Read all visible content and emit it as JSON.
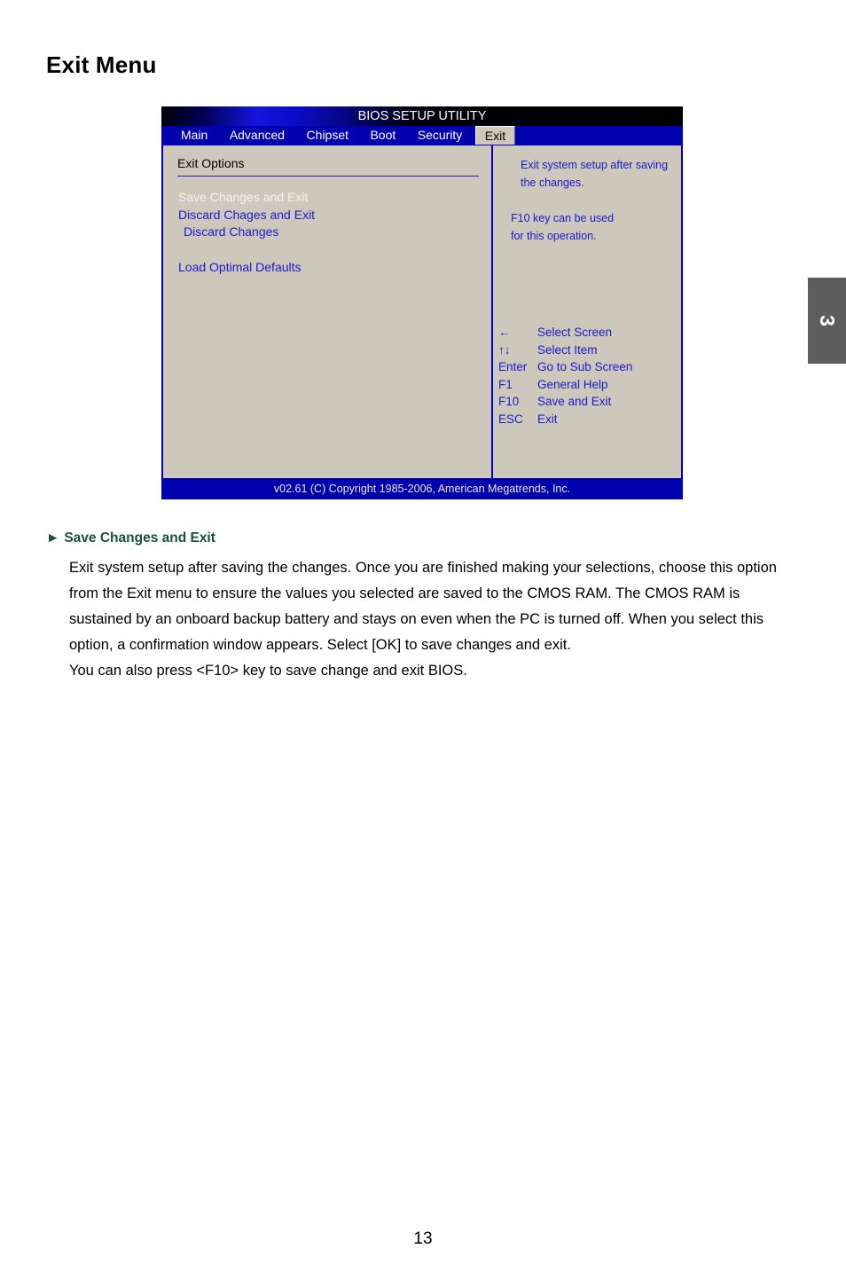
{
  "page": {
    "title": "Exit Menu",
    "chapter_tab": "3",
    "page_number": "13"
  },
  "bios": {
    "title_bar": "BIOS SETUP UTILITY",
    "menu_tabs": [
      {
        "label": "Main",
        "active": false
      },
      {
        "label": "Advanced",
        "active": false
      },
      {
        "label": "Chipset",
        "active": false
      },
      {
        "label": "Boot",
        "active": false
      },
      {
        "label": "Security",
        "active": false
      },
      {
        "label": "Exit",
        "active": true
      }
    ],
    "panel_header": "Exit Options",
    "options": [
      {
        "label": "Save Changes and Exit",
        "selected": true
      },
      {
        "label": "Discard Chages and Exit",
        "selected": false
      },
      {
        "label": "Discard Changes",
        "selected": false
      },
      {
        "label": "Load Optimal Defaults",
        "selected": false
      }
    ],
    "help": {
      "line1": "Exit system setup after saving",
      "line2": "the changes.",
      "line3": "F10 key can be used",
      "line4": "for this operation."
    },
    "key_legend": [
      {
        "key": "←",
        "action": "Select Screen"
      },
      {
        "key": "↑↓",
        "action": "Select Item"
      },
      {
        "key": "Enter",
        "action": "Go to Sub Screen"
      },
      {
        "key": "F1",
        "action": "General Help"
      },
      {
        "key": "F10",
        "action": "Save and Exit"
      },
      {
        "key": "ESC",
        "action": "Exit"
      }
    ],
    "footer": "v02.61 (C) Copyright 1985-2006, American Megatrends, Inc."
  },
  "section": {
    "bullet": "►",
    "heading": "Save Changes and Exit",
    "paragraph1": "Exit system setup after saving the changes. Once you are finished making your selections, choose this option from the Exit menu to ensure the values you selected are saved to the CMOS RAM. The CMOS RAM is sustained by an onboard backup battery and stays on even when the PC is turned off. When you select this option, a confirmation window appears. Select [OK] to save changes and exit.",
    "paragraph2": "You can also press <F10> key to save change and exit BIOS."
  },
  "colors": {
    "bios_blue": "#0000ac",
    "bios_panel": "#cdc8bb",
    "bios_text_blue": "#1a1aca",
    "heading_green": "#17503c",
    "tab_gray": "#5d5d5d"
  }
}
